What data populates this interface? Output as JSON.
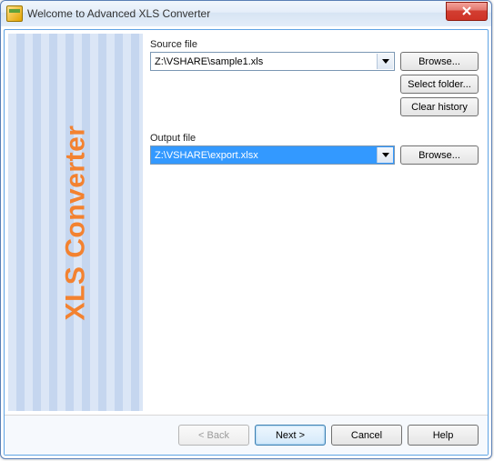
{
  "window": {
    "title": "Welcome to Advanced XLS Converter"
  },
  "banner": {
    "text": "XLS Converter"
  },
  "source": {
    "label": "Source file",
    "value": "Z:\\VSHARE\\sample1.xls",
    "browse": "Browse...",
    "selectFolder": "Select folder...",
    "clearHistory": "Clear history"
  },
  "output": {
    "label": "Output file",
    "value": "Z:\\VSHARE\\export.xlsx",
    "browse": "Browse..."
  },
  "footer": {
    "back": "< Back",
    "next": "Next >",
    "cancel": "Cancel",
    "help": "Help"
  }
}
